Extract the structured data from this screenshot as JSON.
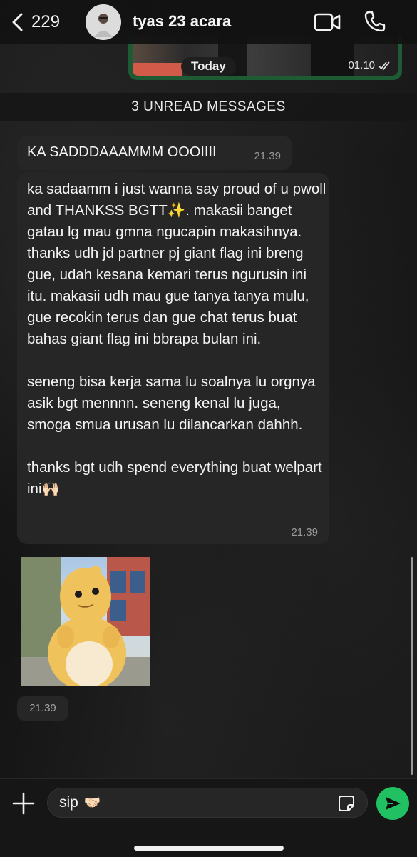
{
  "header": {
    "back_count": "229",
    "chat_title": "tyas 23 acara",
    "icons": {
      "back": "chevron-left-icon",
      "video": "video-camera-icon",
      "call": "phone-icon"
    }
  },
  "previous_message": {
    "time": "01.10",
    "status": "read"
  },
  "date_separator": "Today",
  "unread_banner": "3 UNREAD MESSAGES",
  "messages": [
    {
      "text": "KA SADDDAAAMMM OOOIIII",
      "time": "21.39"
    },
    {
      "text": "ka sadaamm i just wanna say proud of u pwoll and THANKSS BGTT✨. makasii banget gatau lg mau gmna ngucapin makasihnya. thanks udh jd partner pj giant flag ini breng gue, udah kesana kemari terus ngurusin ini itu. makasii udh mau gue tanya tanya mulu, gue recokin terus dan gue chat terus buat bahas giant flag ini bbrapa bulan ini.\n\nseneng bisa kerja sama lu soalnya lu orgnya asik bgt mennnn. seneng kenal lu juga, smoga smua urusan lu dilancarkan dahhh.\n\nthanks bgt udh spend everything buat welpart ini🙌🏻",
      "time": "21.39"
    },
    {
      "type": "sticker",
      "time": "21.39"
    }
  ],
  "composer": {
    "value": "sip",
    "value_emoji": "🤝🏻",
    "icons": {
      "add": "plus-icon",
      "sticker": "sticker-icon",
      "send": "send-icon"
    }
  },
  "colors": {
    "accent_green": "#21c063",
    "incoming_bubble": "#262626",
    "outgoing_bubble": "#1e5a34"
  }
}
